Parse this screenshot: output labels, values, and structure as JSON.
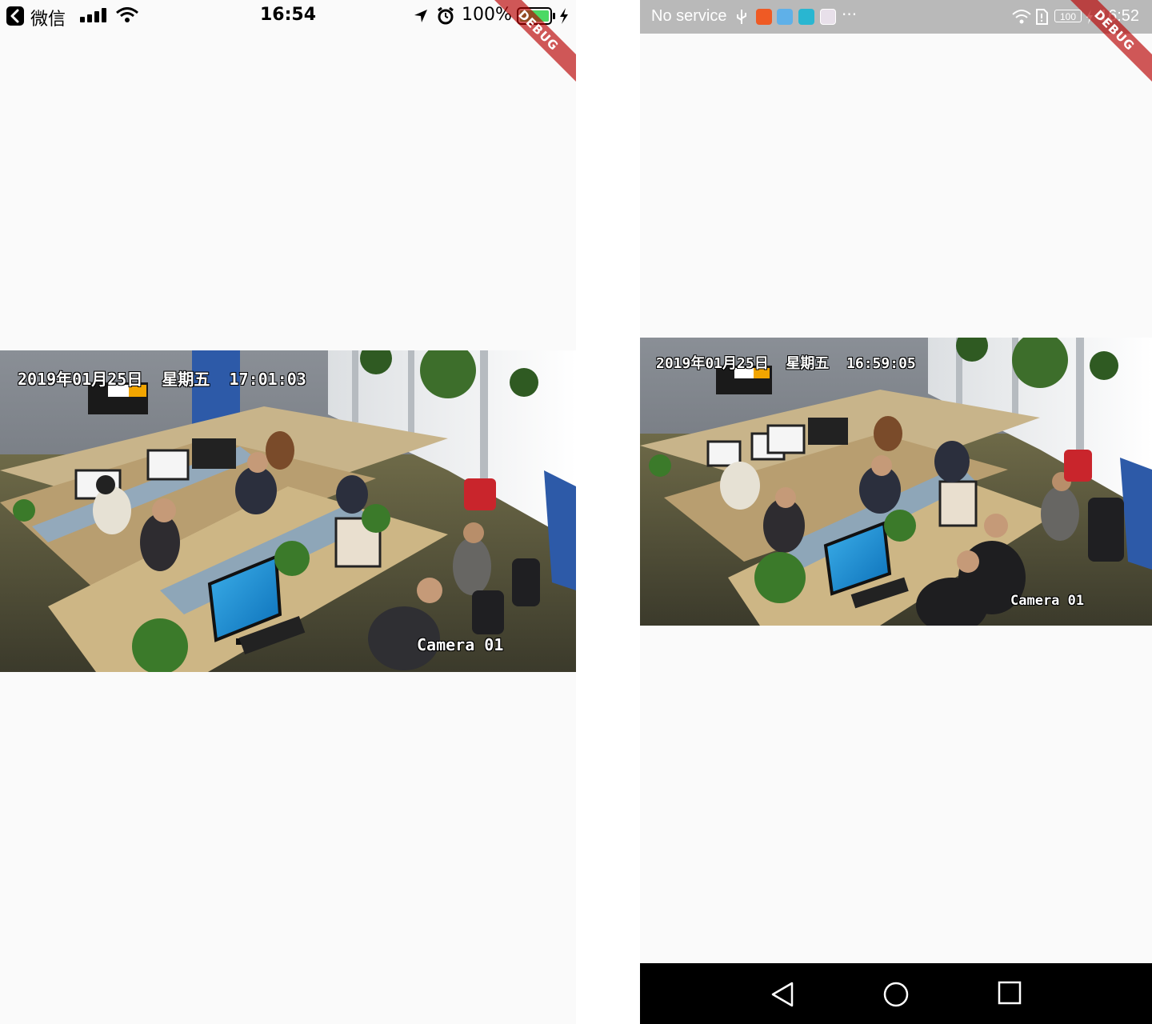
{
  "ios": {
    "status_bar": {
      "back_app": "微信",
      "time": "16:54",
      "battery_percent": "100%"
    },
    "debug_banner": "DEBUG",
    "video": {
      "timestamp": "2019年01月25日  星期五  17:01:03",
      "camera_label": "Camera 01"
    }
  },
  "android": {
    "status_bar": {
      "carrier": "No service",
      "battery": "100",
      "time": "16:52"
    },
    "debug_banner": "DEBUG",
    "video": {
      "timestamp": "2019年01月25日  星期五  16:59:05",
      "camera_label": "Camera 01"
    },
    "nav_bar": {
      "icons": [
        "back-icon",
        "home-icon",
        "recents-icon"
      ]
    }
  },
  "colors": {
    "background": "#fafafa",
    "android_status_bg": "#b9b9b9",
    "debug_ribbon": "#b80000",
    "ios_battery": "#4cd964",
    "nav_bar": "#000000"
  }
}
